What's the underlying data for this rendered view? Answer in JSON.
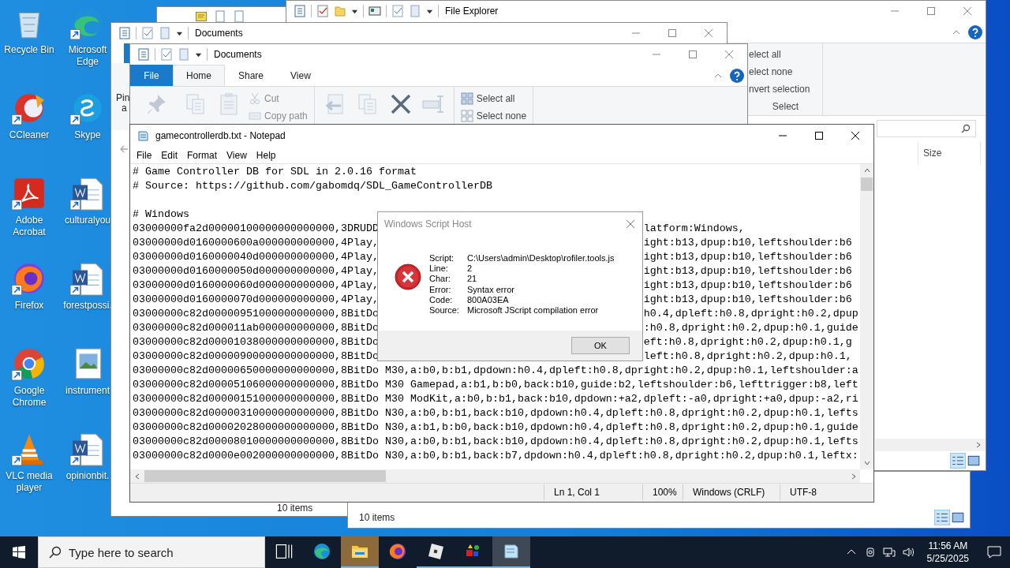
{
  "desktop_icons": [
    {
      "label": "Recycle Bin",
      "kind": "recycle",
      "shortcut": false
    },
    {
      "label": "Microsoft Edge",
      "kind": "edge",
      "shortcut": true
    },
    {
      "label": "CCleaner",
      "kind": "ccleaner",
      "shortcut": true
    },
    {
      "label": "Skype",
      "kind": "skype",
      "shortcut": true
    },
    {
      "label": "Adobe Acrobat",
      "kind": "acrobat",
      "shortcut": true
    },
    {
      "label": "culturalyou",
      "kind": "word",
      "shortcut": true
    },
    {
      "label": "Firefox",
      "kind": "firefox",
      "shortcut": true
    },
    {
      "label": "forestpossi.",
      "kind": "word",
      "shortcut": true
    },
    {
      "label": "Google Chrome",
      "kind": "chrome",
      "shortcut": true
    },
    {
      "label": "instrument",
      "kind": "image",
      "shortcut": false
    },
    {
      "label": "VLC media player",
      "kind": "vlc",
      "shortcut": true
    },
    {
      "label": "opinionbit.",
      "kind": "word",
      "shortcut": true
    }
  ],
  "file_explorer": {
    "title": "File Explorer",
    "select_items": [
      "elect all",
      "elect none",
      "nvert selection"
    ],
    "group_label": "Select",
    "column": "Size"
  },
  "documents_back": {
    "title": "Documents",
    "pin_label": [
      "Pin",
      "a"
    ],
    "status": "10 items"
  },
  "documents_front": {
    "title": "Documents",
    "tabs": [
      {
        "label": "File",
        "kind": "menu",
        "selected": false
      },
      {
        "label": "Home",
        "kind": "tab",
        "selected": true
      },
      {
        "label": "Share",
        "kind": "tab",
        "selected": false
      },
      {
        "label": "View",
        "kind": "tab",
        "selected": false
      }
    ],
    "ribbon": [
      {
        "items": [
          {
            "kind": "pin",
            "disabled": true
          },
          {
            "kind": "copy",
            "disabled": true
          },
          {
            "kind": "paste",
            "disabled": true
          },
          {
            "label": "Cut",
            "kind": "cut",
            "disabled": true
          },
          {
            "label": "Copy path",
            "kind": "copypath",
            "disabled": true
          }
        ]
      },
      {
        "items": [
          {
            "kind": "move",
            "disabled": true
          },
          {
            "kind": "copyto",
            "disabled": true
          },
          {
            "kind": "delete",
            "disabled": false
          },
          {
            "kind": "rename",
            "disabled": true
          }
        ]
      },
      {
        "items": [
          {
            "label": "Select all",
            "kind": "selectall",
            "disabled": false
          },
          {
            "label": "Select none",
            "kind": "selectnone",
            "disabled": false
          }
        ]
      }
    ]
  },
  "explorer_bottom": {
    "status": "10 items"
  },
  "notepad": {
    "title": "gamecontrollerdb.txt - Notepad",
    "menu": [
      "File",
      "Edit",
      "Format",
      "View",
      "Help"
    ],
    "lines": [
      {
        "kind": "text",
        "text": "# Game Controller DB for SDL in 2.0.16 format"
      },
      {
        "kind": "text",
        "text": "# Source: https://github.com/gabomdq/SDL_GameControllerDB"
      },
      {
        "kind": "blank"
      },
      {
        "kind": "text",
        "text": "# Windows"
      },
      {
        "kind": "text",
        "text": "03000000fa2d00000100000000000000,3DRUDD",
        "tail": "latform:Windows,"
      },
      {
        "kind": "text",
        "text": "03000000d0160000600a000000000000,4Play,",
        "tail": "ight:b13,dpup:b10,leftshoulder:b6"
      },
      {
        "kind": "text",
        "text": "03000000d0160000040d000000000000,4Play,",
        "tail": "ight:b13,dpup:b10,leftshoulder:b6"
      },
      {
        "kind": "text",
        "text": "03000000d0160000050d000000000000,4Play,",
        "tail": "ight:b13,dpup:b10,leftshoulder:b6"
      },
      {
        "kind": "text",
        "text": "03000000d0160000060d000000000000,4Play,",
        "tail": "ight:b13,dpup:b10,leftshoulder:b6"
      },
      {
        "kind": "text",
        "text": "03000000d0160000070d000000000000,4Play,",
        "tail": "ight:b13,dpup:b10,leftshoulder:b6"
      },
      {
        "kind": "text",
        "text": "03000000c82d00000951000000000000,8BitDo",
        "tail": "h0.4,dpleft:h0.8,dpright:h0.2,dpup"
      },
      {
        "kind": "text",
        "text": "03000000c82d000011ab000000000000,8BitDo",
        "tail": ":h0.8,dpright:h0.2,dpup:h0.1,guide"
      },
      {
        "kind": "text",
        "text": "03000000c82d00001038000000000000,8BitDo",
        "tail": "eft:h0.8,dpright:h0.2,dpup:h0.1,g"
      },
      {
        "kind": "text",
        "text": "03000000c82d00000900000000000000,8BitDo",
        "tail": "left:h0.8,dpright:h0.2,dpup:h0.1,"
      },
      {
        "kind": "text",
        "text": "03000000c82d00000650000000000000,8BitDo M30,a:b0,b:b1,dpdown:h0.4,dpleft:h0.8,dpright:h0.2,dpup:h0.1,leftshoulder:a"
      },
      {
        "kind": "text",
        "text": "03000000c82d00005106000000000000,8BitDo M30 Gamepad,a:b1,b:b0,back:b10,guide:b2,leftshoulder:b6,lefttrigger:b8,left"
      },
      {
        "kind": "text",
        "text": "03000000c82d00000151000000000000,8BitDo M30 ModKit,a:b0,b:b1,back:b10,dpdown:+a2,dpleft:-a0,dpright:+a0,dpup:-a2,ri"
      },
      {
        "kind": "text",
        "text": "03000000c82d00000310000000000000,8BitDo N30,a:b0,b:b1,back:b10,dpdown:h0.4,dpleft:h0.8,dpright:h0.2,dpup:h0.1,lefts"
      },
      {
        "kind": "text",
        "text": "03000000c82d00002028000000000000,8BitDo N30,a:b1,b:b0,back:b10,dpdown:h0.4,dpleft:h0.8,dpright:h0.2,dpup:h0.1,guide"
      },
      {
        "kind": "text",
        "text": "03000000c82d00008010000000000000,8BitDo N30,a:b0,b:b1,back:b10,dpdown:h0.4,dpleft:h0.8,dpright:h0.2,dpup:h0.1,lefts"
      },
      {
        "kind": "text",
        "text": "03000000c82d0000e002000000000000,8BitDo N30,a:b0,b:b1,back:b7,dpdown:h0.4,dpleft:h0.8,dpright:h0.2,dpup:h0.1,leftx:"
      }
    ],
    "status": [
      "Ln 1, Col 1",
      "100%",
      "Windows (CRLF)",
      "UTF-8"
    ]
  },
  "dialog": {
    "title": "Windows Script Host",
    "fields": [
      {
        "label": "Script:",
        "value": "C:\\Users\\admin\\Desktop\\rofiler.tools.js"
      },
      {
        "label": "Line:",
        "value": "2"
      },
      {
        "label": "Char:",
        "value": "21"
      },
      {
        "label": "Error:",
        "value": "Syntax error"
      },
      {
        "label": "Code:",
        "value": "800A03EA"
      },
      {
        "label": "Source:",
        "value": "Microsoft JScript compilation error"
      }
    ],
    "button": "OK"
  },
  "taskbar": {
    "search": {
      "placeholder": "Type here to search"
    },
    "apps": [
      {
        "kind": "edge",
        "running": false,
        "active": false,
        "attention": false
      },
      {
        "kind": "explorer",
        "running": true,
        "active": false,
        "attention": true
      },
      {
        "kind": "firefox",
        "running": false,
        "active": false,
        "attention": false
      },
      {
        "kind": "roblox",
        "running": true,
        "active": false,
        "attention": false
      },
      {
        "kind": "shapes",
        "running": true,
        "active": false,
        "attention": false
      },
      {
        "kind": "notepad",
        "running": true,
        "active": true,
        "attention": false
      }
    ],
    "time": "11:56 AM",
    "date": "5/25/2025"
  }
}
